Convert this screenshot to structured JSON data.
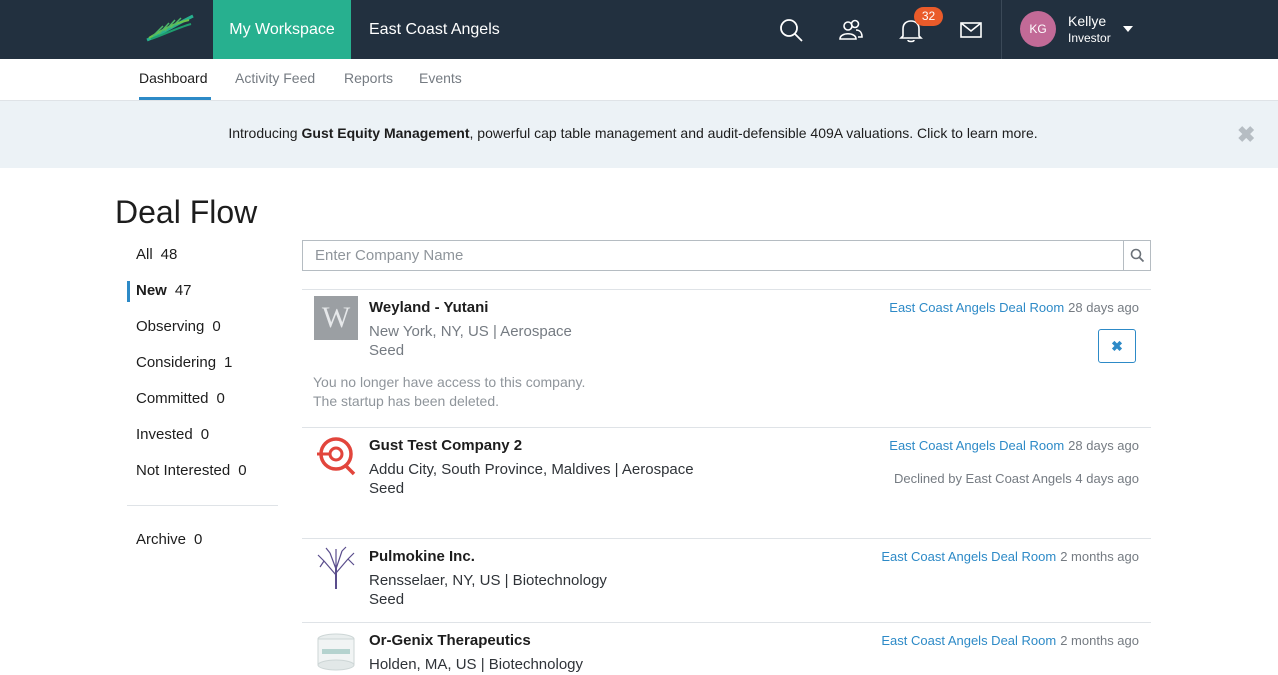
{
  "topbar": {
    "workspace_tab": "My Workspace",
    "group_tab": "East Coast Angels",
    "notification_count": "32",
    "user": {
      "initials": "KG",
      "name": "Kellye",
      "role": "Investor"
    }
  },
  "subnav": {
    "tabs": [
      "Dashboard",
      "Activity Feed",
      "Reports",
      "Events"
    ],
    "active": "Dashboard"
  },
  "banner": {
    "prefix": "Introducing ",
    "bold": "Gust Equity Management",
    "suffix": ", powerful cap table management and audit-defensible 409A valuations. Click to learn more.",
    "close": "✖"
  },
  "page": {
    "title": "Deal Flow"
  },
  "filters": [
    {
      "label": "All",
      "count": "48"
    },
    {
      "label": "New",
      "count": "47"
    },
    {
      "label": "Observing",
      "count": "0"
    },
    {
      "label": "Considering",
      "count": "1"
    },
    {
      "label": "Committed",
      "count": "0"
    },
    {
      "label": "Invested",
      "count": "0"
    },
    {
      "label": "Not Interested",
      "count": "0"
    },
    {
      "label": "Archive",
      "count": "0"
    }
  ],
  "search": {
    "placeholder": "Enter Company Name"
  },
  "deals": [
    {
      "name": "Weyland - Yutani",
      "location": "New York, NY, US | Aerospace",
      "stage": "Seed",
      "source": "East Coast Angels Deal Room",
      "time": "28 days ago",
      "logo_letter": "W",
      "note1": "You no longer have access to this company.",
      "note2": "The startup has been deleted.",
      "remove": "✖"
    },
    {
      "name": "Gust Test Company 2",
      "location": "Addu City, South Province, Maldives | Aerospace",
      "stage": "Seed",
      "source": "East Coast Angels Deal Room",
      "time": "28 days ago",
      "declined": "Declined by East Coast Angels 4 days ago"
    },
    {
      "name": "Pulmokine Inc.",
      "location": "Rensselaer, NY, US | Biotechnology",
      "stage": "Seed",
      "source": "East Coast Angels Deal Room",
      "time": "2 months ago"
    },
    {
      "name": "Or-Genix Therapeutics",
      "location": "Holden, MA, US | Biotechnology",
      "source": "East Coast Angels Deal Room",
      "time": "2 months ago"
    }
  ],
  "colors": {
    "nav_bg": "#22303f",
    "accent_green": "#27b08f",
    "link_blue": "#2d8ac7",
    "badge": "#ea5b2a"
  }
}
